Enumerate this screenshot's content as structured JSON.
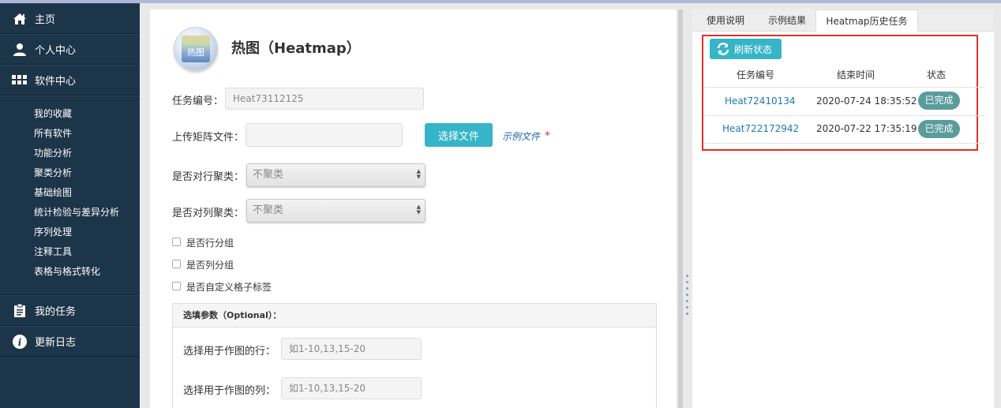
{
  "sidebar": {
    "home": "主页",
    "personal": "个人中心",
    "software": "软件中心",
    "sub_items": [
      "我的收藏",
      "所有软件",
      "功能分析",
      "聚类分析",
      "基础绘图",
      "统计检验与差异分析",
      "序列处理",
      "注释工具",
      "表格与格式转化"
    ],
    "my_tasks": "我的任务",
    "changelog": "更新日志"
  },
  "form": {
    "logo_text": "热图",
    "title": "热图（Heatmap）",
    "task_id_label": "任务编号：",
    "task_id_value": "Heat73112125",
    "upload_label": "上传矩阵文件：",
    "choose_file": "选择文件",
    "example_file": "示例文件",
    "required_mark": "*",
    "row_cluster_label": "是否对行聚类：",
    "row_cluster_value": "不聚类",
    "col_cluster_label": "是否对列聚类：",
    "col_cluster_value": "不聚类",
    "row_group": "是否行分组",
    "col_group": "是否列分组",
    "custom_label": "是否自定义格子标签",
    "optional_title": "选填参数（Optional）：",
    "rows_label": "选择用于作图的行：",
    "rows_placeholder": "如1-10,13,15-20",
    "cols_label": "选择用于作图的列：",
    "cols_placeholder": "如1-10,13,15-20"
  },
  "tabs": [
    "使用说明",
    "示例结果",
    "Heatmap历史任务"
  ],
  "history": {
    "refresh_label": "刷新状态",
    "headers": [
      "任务编号",
      "结束时间",
      "状态"
    ],
    "rows": [
      {
        "id": "Heat72410134",
        "end_time": "2020-07-24 18:35:52",
        "status": "已完成"
      },
      {
        "id": "Heat722172942",
        "end_time": "2020-07-22 17:35:19",
        "status": "已完成"
      }
    ]
  },
  "colors": {
    "sidebar_bg": "#1d3549",
    "accent_teal": "#36b5c8",
    "badge_bg": "#5a9c9c",
    "highlight_red": "#e0302a"
  }
}
